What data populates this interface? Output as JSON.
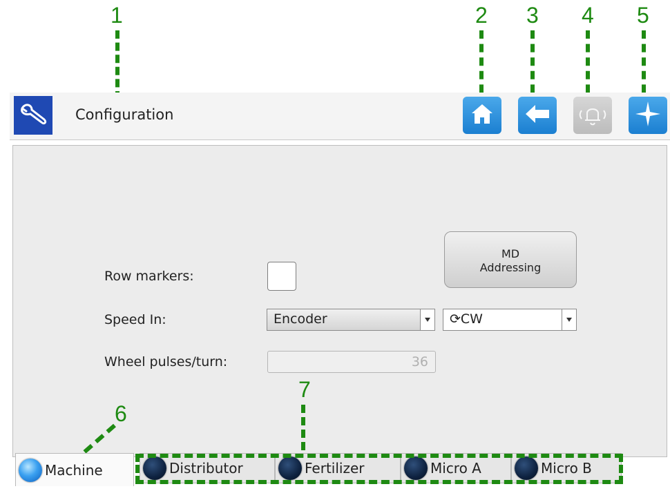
{
  "callouts": [
    "1",
    "2",
    "3",
    "4",
    "5",
    "6",
    "7"
  ],
  "header": {
    "title": "Configuration",
    "app_icon": "wrench-icon",
    "buttons": [
      {
        "name": "home-icon"
      },
      {
        "name": "back-arrow-icon"
      },
      {
        "name": "alarm-bell-icon"
      },
      {
        "name": "compass-icon"
      }
    ]
  },
  "form": {
    "row_markers_label": "Row markers:",
    "speed_in_label": "Speed In:",
    "speed_in_value": "Encoder",
    "direction_value": "⟳CW",
    "wheel_pulses_label": "Wheel pulses/turn:",
    "wheel_pulses_value": "36",
    "md_button_line1": "MD",
    "md_button_line2": "Addressing"
  },
  "tabs": [
    {
      "label": "Machine",
      "active": true
    },
    {
      "label": "Distributor",
      "active": false
    },
    {
      "label": "Fertilizer",
      "active": false
    },
    {
      "label": "Micro A",
      "active": false
    },
    {
      "label": "Micro B",
      "active": false
    }
  ],
  "colors": {
    "accent": "#1b7fd1",
    "callout": "#1e8a12",
    "app_icon_bg": "#1f49b3"
  }
}
